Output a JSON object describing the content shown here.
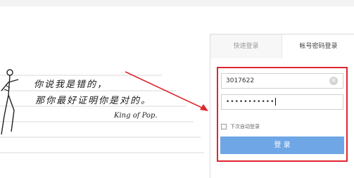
{
  "banner": {
    "line1": "你说我是错的，",
    "line2": "那你最好证明你是对的。",
    "signature": "King of Pop."
  },
  "login": {
    "tabs": [
      {
        "label": "快速登录",
        "active": false
      },
      {
        "label": "帐号密码登录",
        "active": true
      }
    ],
    "username_value": "3017622",
    "password_mask": "•••••••••••",
    "remember_label": "下次自动登录",
    "remember_checked": false,
    "login_button_label": "登 录"
  },
  "colors": {
    "accent_button": "#6ea6e6",
    "highlight": "#e0262f"
  }
}
